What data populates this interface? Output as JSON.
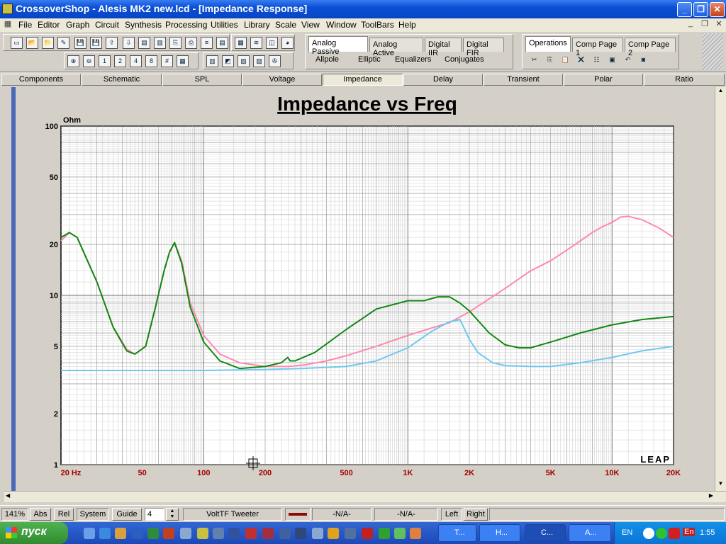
{
  "window": {
    "title": "CrossoverShop - Alesis MK2 new.lcd - [Impedance Response]"
  },
  "menu": [
    "File",
    "Editor",
    "Graph",
    "Circuit",
    "Synthesis",
    "Processing",
    "Utilities",
    "Library",
    "Scale",
    "View",
    "Window",
    "ToolBars",
    "Help"
  ],
  "panels": {
    "synthesis_tabs": [
      "Analog Passive",
      "Analog Active",
      "Digital IIR",
      "Digital FIR"
    ],
    "synthesis_sub": [
      "Allpole",
      "Elliptic",
      "Equalizers",
      "Conjugates"
    ],
    "ops_tabs": [
      "Operations",
      "Comp Page 1",
      "Comp Page 2"
    ]
  },
  "view_tabs": [
    "Components",
    "Schematic",
    "SPL",
    "Voltage",
    "Impedance",
    "Delay",
    "Transient",
    "Polar",
    "Ratio"
  ],
  "chart_data": {
    "type": "line",
    "title": "Impedance vs Freq",
    "ylabel": "Ohm",
    "xscale": "log",
    "yscale": "log",
    "xlim": [
      20,
      20000
    ],
    "ylim": [
      1,
      100
    ],
    "xticks": [
      "20 Hz",
      "50",
      "100",
      "200",
      "500",
      "1K",
      "2K",
      "5K",
      "10K",
      "20K"
    ],
    "yticks": [
      "100",
      "50",
      "20",
      "10",
      "5",
      "2",
      "1"
    ],
    "grid": true,
    "watermark": "LEAP",
    "series": [
      {
        "color": "#ff88b0",
        "x": [
          20,
          22,
          24,
          30,
          36,
          42,
          46,
          52,
          58,
          64,
          68,
          72,
          78,
          86,
          100,
          120,
          150,
          200,
          260,
          320,
          400,
          500,
          700,
          1000,
          1300,
          1600,
          2000,
          3000,
          4000,
          5000,
          6000,
          7000,
          8000,
          9000,
          10000,
          11000,
          12000,
          14000,
          17000,
          20000
        ],
        "y": [
          21,
          23.5,
          22,
          12,
          6.5,
          4.8,
          4.5,
          5,
          8.5,
          14,
          18,
          20.5,
          16,
          9,
          5.8,
          4.5,
          4,
          3.8,
          3.8,
          3.9,
          4.1,
          4.4,
          5,
          5.8,
          6.4,
          6.9,
          8,
          11,
          14,
          16,
          18.5,
          21,
          23.5,
          25.5,
          27,
          29,
          29.3,
          28,
          25,
          22
        ]
      },
      {
        "color": "#118811",
        "x": [
          20,
          22,
          24,
          30,
          36,
          42,
          46,
          52,
          58,
          64,
          68,
          72,
          78,
          86,
          100,
          120,
          150,
          200,
          240,
          258,
          265,
          280,
          350,
          500,
          700,
          1000,
          1200,
          1400,
          1600,
          1800,
          2000,
          2500,
          3000,
          3500,
          4000,
          5000,
          7000,
          10000,
          14000,
          20000
        ],
        "y": [
          22,
          23.5,
          22,
          12,
          6.5,
          4.7,
          4.5,
          5,
          8.5,
          14,
          18,
          20.5,
          15.5,
          8.5,
          5.3,
          4.1,
          3.7,
          3.8,
          4.0,
          4.3,
          4.1,
          4.1,
          4.6,
          6.3,
          8.3,
          9.3,
          9.3,
          9.8,
          9.8,
          9,
          8.1,
          6,
          5.1,
          4.9,
          4.9,
          5.3,
          6,
          6.7,
          7.2,
          7.5
        ]
      },
      {
        "color": "#70c8f0",
        "x": [
          20,
          50,
          100,
          200,
          300,
          500,
          700,
          1000,
          1300,
          1600,
          1800,
          2000,
          2200,
          2600,
          3000,
          4000,
          5000,
          7000,
          10000,
          14000,
          20000
        ],
        "y": [
          3.6,
          3.6,
          3.6,
          3.65,
          3.7,
          3.8,
          4.1,
          4.9,
          6.1,
          7.0,
          7.2,
          5.5,
          4.6,
          4.0,
          3.85,
          3.8,
          3.8,
          4.0,
          4.3,
          4.7,
          5.0
        ]
      }
    ]
  },
  "status": {
    "zoom": "141%",
    "abs": "Abs",
    "rel": "Rel",
    "system": "System",
    "guide": "Guide",
    "guide_value": "4",
    "curve": "VoltTF Tweeter",
    "na1": "-N/A-",
    "na2": "-N/A-",
    "left": "Left",
    "right": "Right"
  },
  "taskbar": {
    "start": "пуск",
    "tasks": [
      "T...",
      "H...",
      "C...",
      "A..."
    ],
    "lang": "EN",
    "kb": "En",
    "clock": "1:55"
  }
}
